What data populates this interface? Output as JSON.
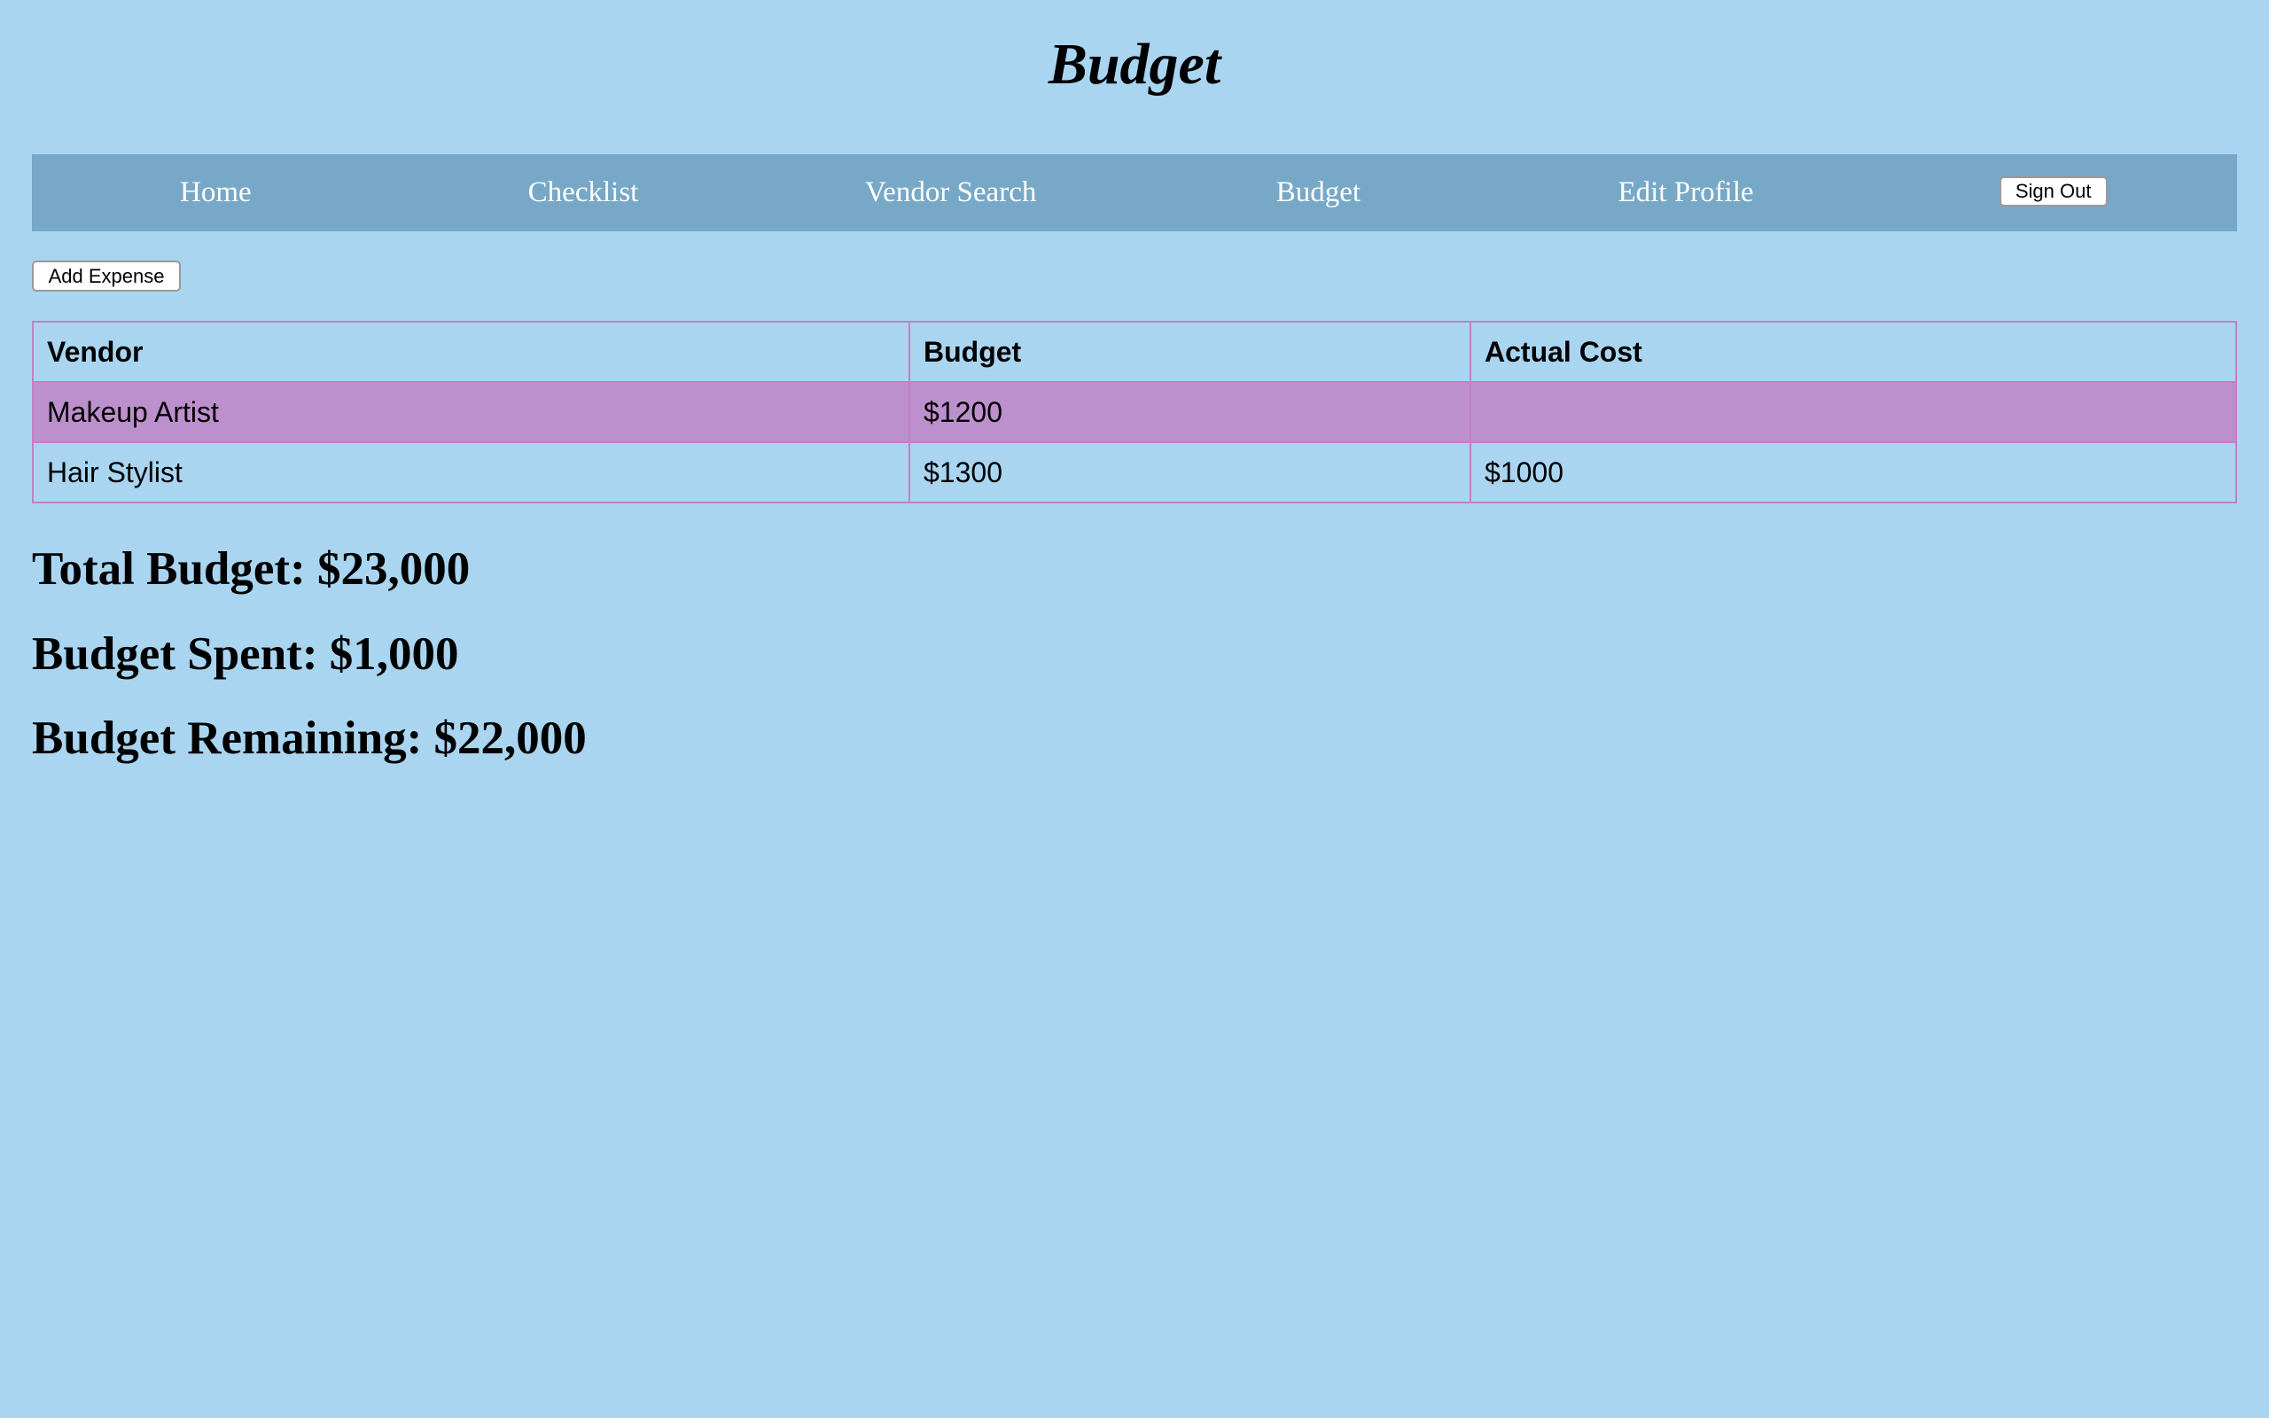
{
  "page": {
    "title": "Budget"
  },
  "nav": {
    "items": [
      {
        "label": "Home"
      },
      {
        "label": "Checklist"
      },
      {
        "label": "Vendor Search"
      },
      {
        "label": "Budget"
      },
      {
        "label": "Edit Profile"
      }
    ],
    "sign_out_label": "Sign Out"
  },
  "toolbar": {
    "add_expense_label": "Add Expense"
  },
  "table": {
    "headers": [
      "Vendor",
      "Budget",
      "Actual Cost"
    ],
    "rows": [
      {
        "vendor": "Makeup Artist",
        "budget": "$1200",
        "actual_cost": ""
      },
      {
        "vendor": "Hair Stylist",
        "budget": "$1300",
        "actual_cost": "$1000"
      }
    ]
  },
  "summary": {
    "total_budget": "Total Budget: $23,000",
    "budget_spent": "Budget Spent: $1,000",
    "budget_remaining": "Budget Remaining: $22,000"
  },
  "colors": {
    "background": "#a9d5f0",
    "navbar": "#78a8c7",
    "nav_text": "#ffffff",
    "table_border": "#c47fc4",
    "highlight_row": "#bc90cc"
  }
}
